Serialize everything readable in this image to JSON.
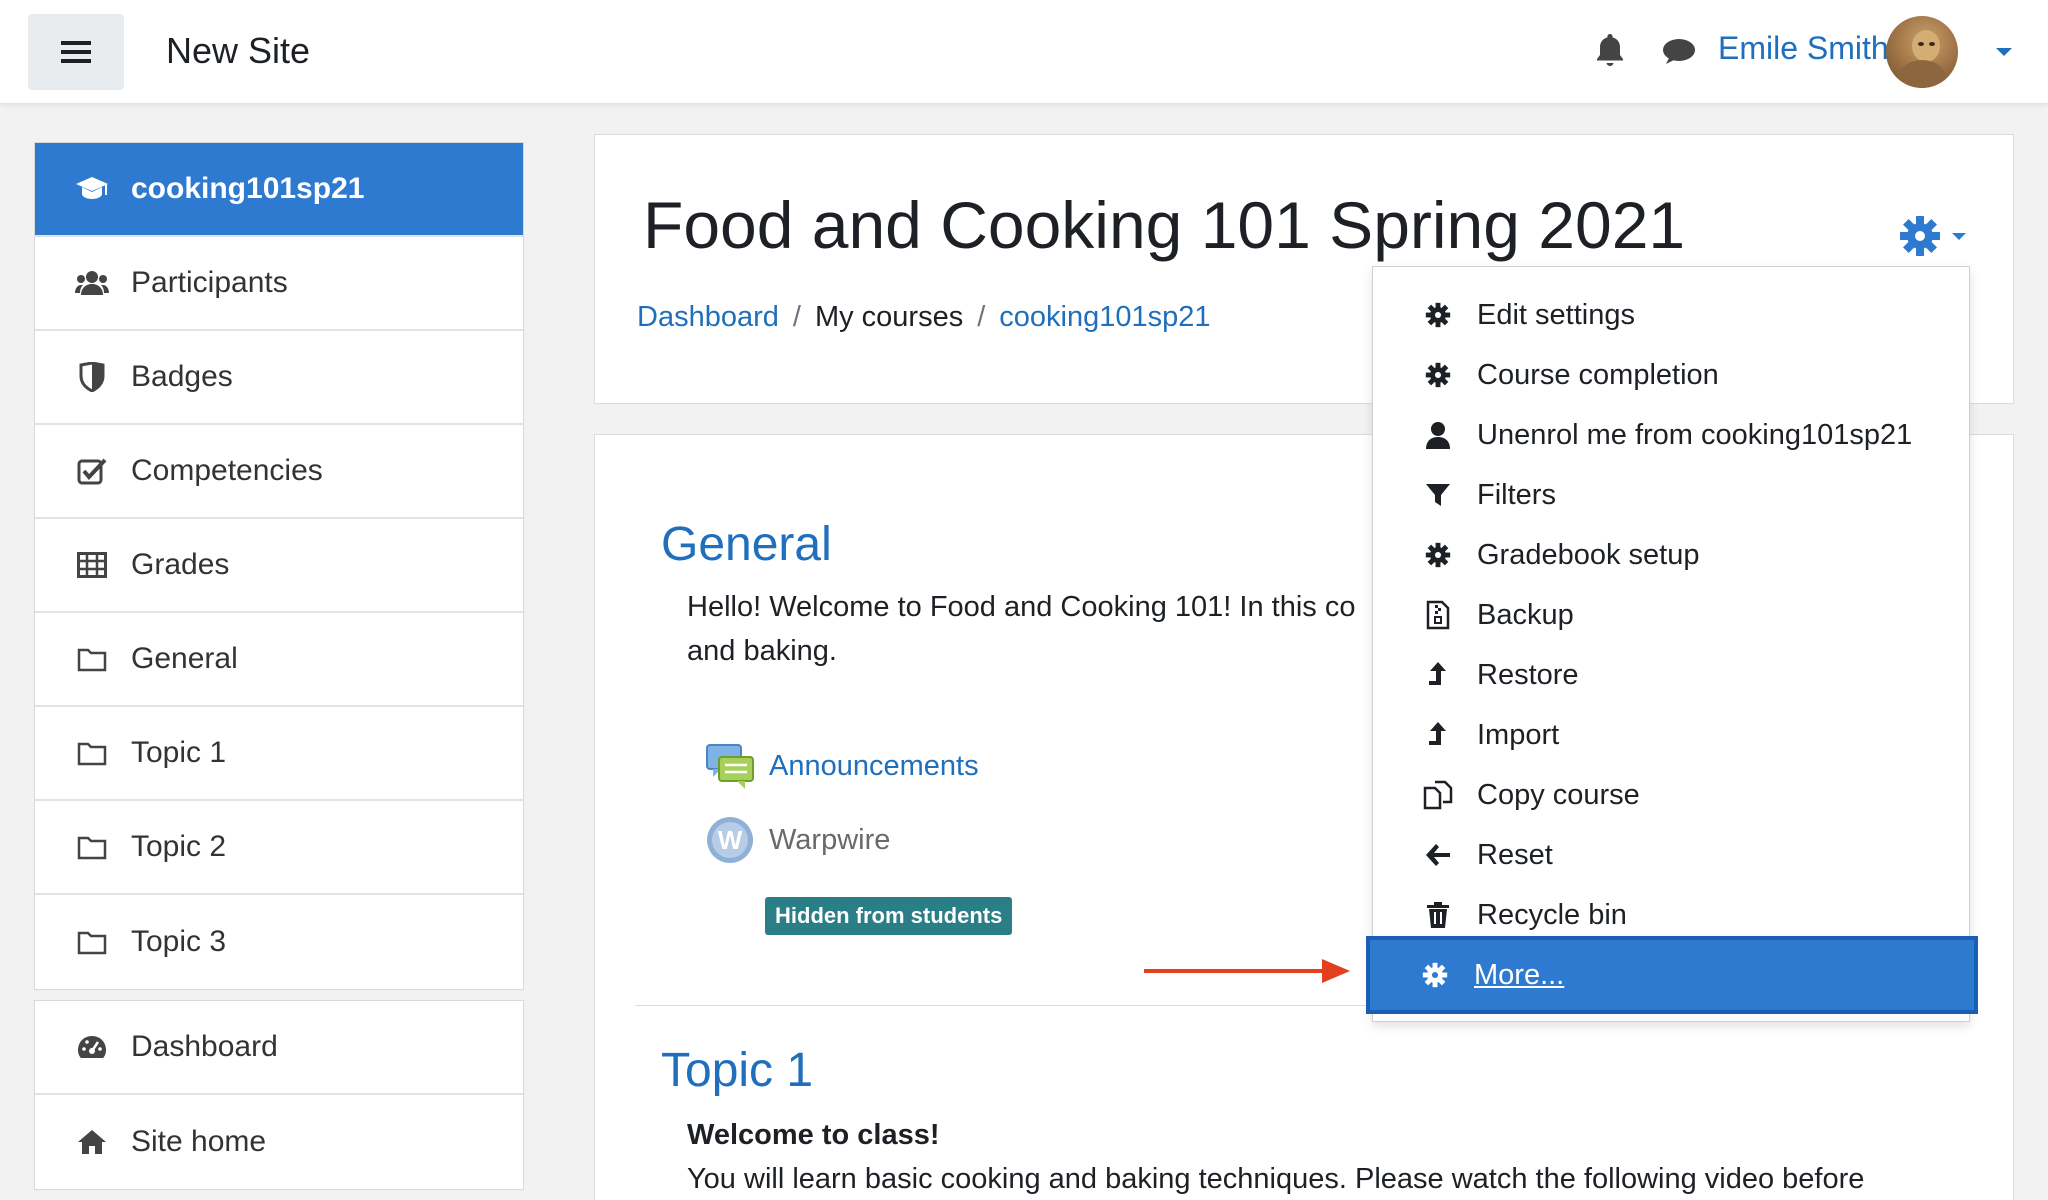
{
  "navbar": {
    "site_name": "New Site",
    "user_name": "Emile Smith",
    "icons": [
      "hamburger-icon",
      "bell-icon",
      "chat-icon",
      "caret-down-icon"
    ]
  },
  "sidebar": {
    "course_items": [
      {
        "label": "cooking101sp21",
        "icon": "graduation-cap-icon",
        "active": true
      },
      {
        "label": "Participants",
        "icon": "users-icon"
      },
      {
        "label": "Badges",
        "icon": "shield-icon"
      },
      {
        "label": "Competencies",
        "icon": "checkbox-icon"
      },
      {
        "label": "Grades",
        "icon": "table-icon"
      },
      {
        "label": "General",
        "icon": "folder-icon"
      },
      {
        "label": "Topic 1",
        "icon": "folder-icon"
      },
      {
        "label": "Topic 2",
        "icon": "folder-icon"
      },
      {
        "label": "Topic 3",
        "icon": "folder-icon"
      }
    ],
    "site_items": [
      {
        "label": "Dashboard",
        "icon": "dashboard-icon"
      },
      {
        "label": "Site home",
        "icon": "home-icon"
      }
    ]
  },
  "header": {
    "title": "Food and Cooking 101 Spring 2021",
    "breadcrumb": {
      "dashboard": "Dashboard",
      "my_courses": "My courses",
      "course": "cooking101sp21",
      "separator": "/"
    }
  },
  "content": {
    "general": {
      "title": "General",
      "line1": "Hello! Welcome to Food and Cooking 101! In this co",
      "line2": "and baking."
    },
    "activities": {
      "announcements": "Announcements",
      "warpwire": "Warpwire",
      "hidden_badge": "Hidden from students"
    },
    "topic1": {
      "title": "Topic 1",
      "subtitle": "Welcome to class!",
      "text": "You will learn basic cooking and baking techniques. Please watch the following video before"
    }
  },
  "dropdown": {
    "items": [
      {
        "label": "Edit settings",
        "icon": "gear-icon"
      },
      {
        "label": "Course completion",
        "icon": "gear-icon"
      },
      {
        "label": "Unenrol me from cooking101sp21",
        "icon": "user-icon"
      },
      {
        "label": "Filters",
        "icon": "filter-icon"
      },
      {
        "label": "Gradebook setup",
        "icon": "gear-icon"
      },
      {
        "label": "Backup",
        "icon": "file-zip-icon"
      },
      {
        "label": "Restore",
        "icon": "upload-arrow-icon"
      },
      {
        "label": "Import",
        "icon": "upload-arrow-icon"
      },
      {
        "label": "Copy course",
        "icon": "copy-icon"
      },
      {
        "label": "Reset",
        "icon": "arrow-left-icon"
      },
      {
        "label": "Recycle bin",
        "icon": "trash-icon"
      },
      {
        "label": "More...",
        "icon": "gear-icon",
        "selected": true
      }
    ]
  },
  "colors": {
    "accent": "#2f7ad1",
    "link": "#1f6fbd",
    "badge": "#2a7e86",
    "annotation_arrow": "#e2401c"
  }
}
